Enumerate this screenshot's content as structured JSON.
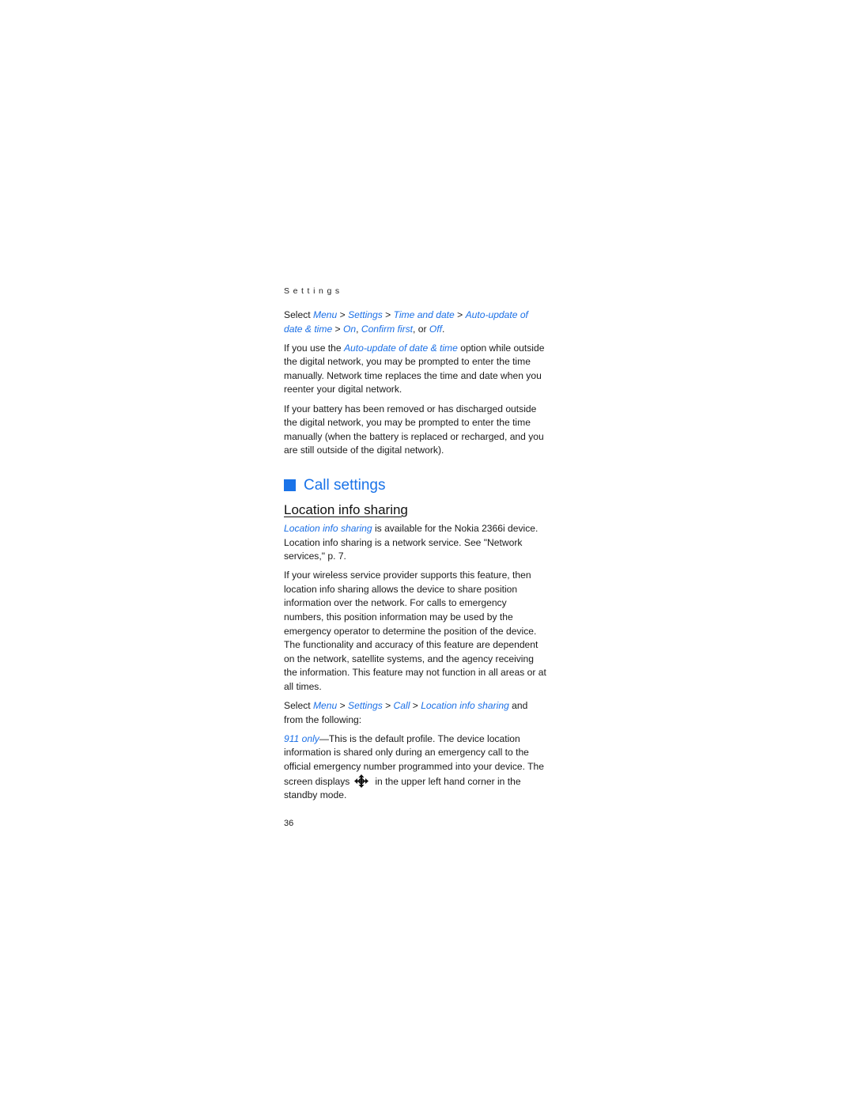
{
  "header": {
    "section": "Settings"
  },
  "sections": {
    "time_auto": {
      "select": "Select",
      "menu": "Menu",
      "settings": "Settings",
      "time_and_date": "Time and date",
      "auto_update": "Auto-update of date & time",
      "on": "On",
      "confirm_first": "Confirm first",
      "off": "Off",
      "sep": " > ",
      "comma": ", ",
      "or": ", or ",
      "period": "."
    },
    "auto_update_para": {
      "pre": "If you use the ",
      "link": "Auto-update of date & time",
      "post": " option while outside the digital network, you may be prompted to enter the time manually. Network time replaces the time and date when you reenter your digital network."
    },
    "battery_para": "If your battery has been removed or has discharged outside the digital network, you may be prompted to enter the time manually (when the battery is replaced or recharged, and you are still outside of the digital network).",
    "call_settings_title": "Call settings",
    "location_title": "Location info sharing",
    "location_intro": {
      "link": "Location info sharing",
      "post": " is available for the Nokia 2366i device. Location info sharing is a network service. See \"Network services,\" p. 7."
    },
    "wireless_para": "If your wireless service provider supports this feature, then location info sharing allows the device to share position information over the network. For calls to emergency numbers, this position information may be used by the emergency operator to determine the position of the device. The functionality and accuracy of this feature are dependent on the network, satellite systems, and the agency receiving the information. This feature may not function in all areas or at all times.",
    "select_call": {
      "select": "Select ",
      "menu": "Menu",
      "settings": "Settings",
      "call": "Call",
      "location": "Location info sharing",
      "post": " and from the following:",
      "sep": " > "
    },
    "option_911": {
      "link": "911 only",
      "text": "—This is the default profile. The device location information is shared only during an emergency call to the official emergency number programmed into your device. The screen displays",
      "icon": "location-crosshair-icon",
      "post": "in the upper left hand corner in the standby mode."
    }
  },
  "footer": {
    "page_number": "36"
  },
  "colors": {
    "accent": "#1a73e8",
    "link": "#1a6fe6",
    "text": "#1a1a1a"
  }
}
